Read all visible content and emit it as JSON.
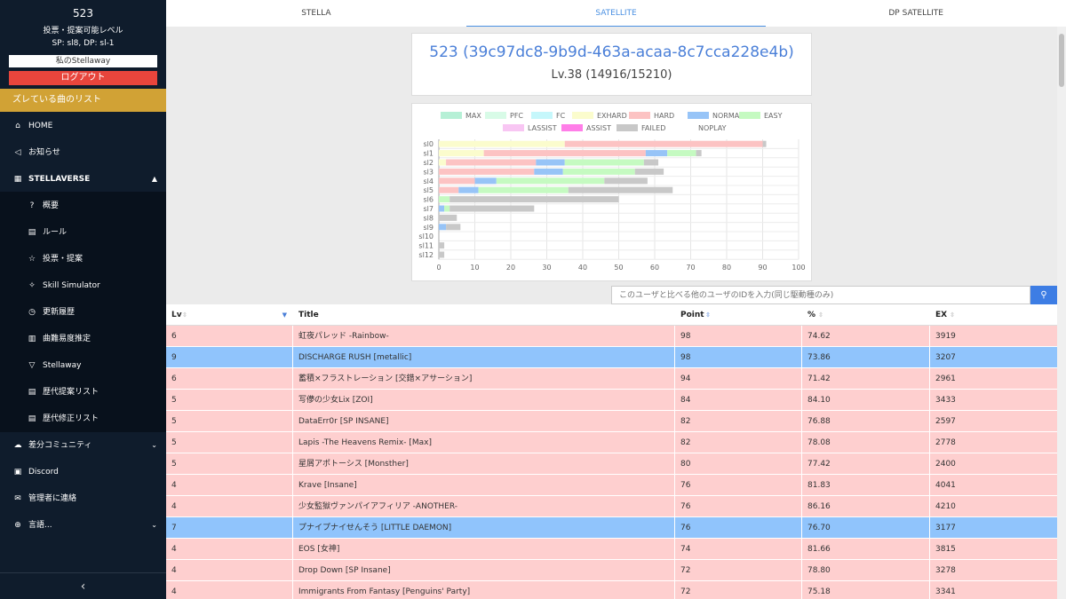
{
  "sidebar": {
    "user_name": "523",
    "level_text": "投票・提案可能レベル",
    "sp_text": "SP: sl8, DP: sl-1",
    "stellaway_box": "私のStellaway",
    "logout": "ログアウト",
    "banner": "ズレている曲のリスト",
    "items": [
      {
        "icon": "⌂",
        "label": "HOME"
      },
      {
        "icon": "◁",
        "label": "お知らせ"
      },
      {
        "icon": "▦",
        "label": "STELLAVERSE",
        "chevron": "▲"
      },
      {
        "icon": "?",
        "label": "概要"
      },
      {
        "icon": "▤",
        "label": "ルール"
      },
      {
        "icon": "☆",
        "label": "投票・提案"
      },
      {
        "icon": "✧",
        "label": "Skill Simulator"
      },
      {
        "icon": "◷",
        "label": "更新履歴"
      },
      {
        "icon": "▥",
        "label": "曲難易度推定"
      },
      {
        "icon": "▽",
        "label": "Stellaway"
      },
      {
        "icon": "▤",
        "label": "歴代提案リスト"
      },
      {
        "icon": "▤",
        "label": "歴代修正リスト"
      },
      {
        "icon": "☁",
        "label": "差分コミュニティ",
        "chevron": "⌄"
      },
      {
        "icon": "▣",
        "label": "Discord"
      },
      {
        "icon": "✉",
        "label": "管理者に連絡"
      },
      {
        "icon": "⊕",
        "label": "言語...",
        "chevron": "⌄"
      }
    ],
    "collapse": "‹"
  },
  "tabs": [
    "STELLA",
    "SATELLITE",
    "DP SATELLITE"
  ],
  "user": {
    "title": "523 (39c97dc8-9b9d-463a-acaa-8c7cca228e4b)",
    "level": "Lv.38 (14916/15210)"
  },
  "chart_data": {
    "type": "bar",
    "orientation": "horizontal",
    "stacked": true,
    "categories": [
      "sl0",
      "sl1",
      "sl2",
      "sl3",
      "sl4",
      "sl5",
      "sl6",
      "sl7",
      "sl8",
      "sl9",
      "sl10",
      "sl11",
      "sl12"
    ],
    "series": [
      {
        "name": "MAX",
        "color": "#b6f0d6",
        "values": [
          0,
          0,
          0,
          0,
          0,
          0,
          0,
          0,
          0,
          0,
          0,
          0,
          0
        ]
      },
      {
        "name": "PFC",
        "color": "#d8fbe7",
        "values": [
          0,
          0,
          0,
          0,
          0,
          0,
          0,
          0,
          0,
          0,
          0,
          0,
          0
        ]
      },
      {
        "name": "FC",
        "color": "#c6f7fb",
        "values": [
          0,
          0,
          0,
          0,
          0,
          0,
          0,
          0,
          0,
          0,
          0,
          0,
          0
        ]
      },
      {
        "name": "EXHARD",
        "color": "#fbfccd",
        "values": [
          35,
          12.5,
          2,
          0,
          0,
          0,
          0,
          0,
          0,
          0,
          0,
          0,
          0
        ]
      },
      {
        "name": "HARD",
        "color": "#fcc3c3",
        "values": [
          55,
          45,
          25,
          26.5,
          10,
          5.5,
          0,
          0,
          0,
          0,
          0,
          0,
          0
        ]
      },
      {
        "name": "NORMAL",
        "color": "#97c4f7",
        "values": [
          0,
          6,
          8,
          8,
          6,
          5.5,
          0,
          1.5,
          0,
          2,
          0,
          0,
          0
        ]
      },
      {
        "name": "EASY",
        "color": "#c5fac1",
        "values": [
          0,
          8,
          22,
          20,
          30,
          25,
          3,
          1.5,
          0,
          0,
          0,
          0,
          0
        ]
      },
      {
        "name": "LASSIST",
        "color": "#f8c6f3",
        "values": [
          0,
          0,
          0,
          0,
          0,
          0,
          0,
          0,
          0,
          0,
          0,
          0,
          0
        ]
      },
      {
        "name": "ASSIST",
        "color": "#ff7ee8",
        "values": [
          0,
          0,
          0,
          0,
          0,
          0,
          0,
          0,
          0,
          0,
          0,
          0,
          0
        ]
      },
      {
        "name": "FAILED",
        "color": "#c8c8c8",
        "values": [
          1,
          1.5,
          4,
          8,
          12,
          29,
          47,
          23.5,
          5,
          4,
          0,
          1.5,
          1.5
        ]
      },
      {
        "name": "NOPLAY",
        "color": "#ffffff",
        "values": [
          0,
          0,
          0,
          0,
          0,
          0,
          0,
          0,
          0,
          0,
          0,
          0,
          0
        ]
      }
    ],
    "xlim": [
      0,
      100
    ],
    "xticks": [
      0,
      10,
      20,
      30,
      40,
      50,
      60,
      70,
      80,
      90,
      100
    ],
    "grid": true,
    "legend": "top"
  },
  "search": {
    "placeholder": "このユーザと比べる他のユーザのIDを入力(同じ駆動種のみ)",
    "button_icon": "⚲"
  },
  "table": {
    "headers": [
      "Lv",
      "Title",
      "Point",
      "%",
      "EX"
    ],
    "rows": [
      {
        "lv": "6",
        "title": "虹夜パレッド -Rainbow-",
        "point": "98",
        "pct": "74.62",
        "ex": "3919",
        "color": "pink"
      },
      {
        "lv": "9",
        "title": "DISCHARGE RUSH [metallic]",
        "point": "98",
        "pct": "73.86",
        "ex": "3207",
        "color": "blue"
      },
      {
        "lv": "6",
        "title": "蓄積×フラストレーション [交錯×アサーション]",
        "point": "94",
        "pct": "71.42",
        "ex": "2961",
        "color": "pink"
      },
      {
        "lv": "5",
        "title": "写儚の少女Lix [ZOI]",
        "point": "84",
        "pct": "84.10",
        "ex": "3433",
        "color": "pink"
      },
      {
        "lv": "5",
        "title": "DataErr0r [SP INSANE]",
        "point": "82",
        "pct": "76.88",
        "ex": "2597",
        "color": "pink"
      },
      {
        "lv": "5",
        "title": "Lapis -The Heavens Remix- [Max]",
        "point": "82",
        "pct": "78.08",
        "ex": "2778",
        "color": "pink"
      },
      {
        "lv": "5",
        "title": "星屑アポトーシス [Monsther]",
        "point": "80",
        "pct": "77.42",
        "ex": "2400",
        "color": "pink"
      },
      {
        "lv": "4",
        "title": "Krave [Insane]",
        "point": "76",
        "pct": "81.83",
        "ex": "4041",
        "color": "pink"
      },
      {
        "lv": "4",
        "title": "少女監獄ヴァンパイアフィリア -ANOTHER-",
        "point": "76",
        "pct": "86.16",
        "ex": "4210",
        "color": "pink"
      },
      {
        "lv": "7",
        "title": "プナイプナイせんそう [LITTLE DAEMON]",
        "point": "76",
        "pct": "76.70",
        "ex": "3177",
        "color": "blue"
      },
      {
        "lv": "4",
        "title": "EOS [女神]",
        "point": "74",
        "pct": "81.66",
        "ex": "3815",
        "color": "pink"
      },
      {
        "lv": "4",
        "title": "Drop Down [SP Insane]",
        "point": "72",
        "pct": "78.80",
        "ex": "3278",
        "color": "pink"
      },
      {
        "lv": "4",
        "title": "Immigrants From Fantasy [Penguins' Party]",
        "point": "72",
        "pct": "75.18",
        "ex": "3341",
        "color": "pink"
      }
    ]
  }
}
